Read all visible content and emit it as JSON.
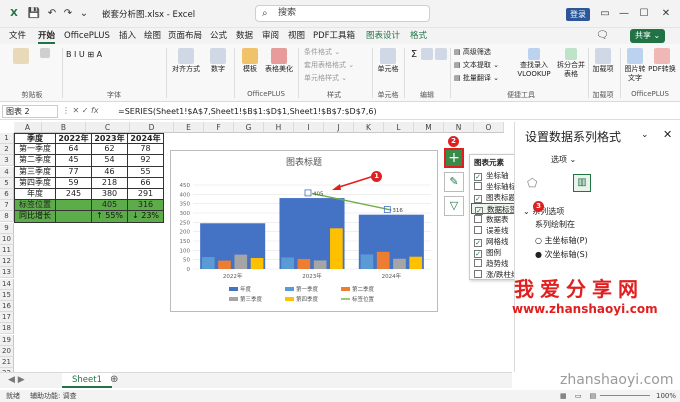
{
  "window": {
    "filename": "嵌套分析图.xlsx",
    "app": "Excel",
    "search_placeholder": "搜索",
    "login": "登录"
  },
  "menu": [
    "文件",
    "开始",
    "OfficePLUS",
    "插入",
    "绘图",
    "页面布局",
    "公式",
    "数据",
    "审阅",
    "视图",
    "PDF工具箱",
    "图表设计",
    "格式"
  ],
  "menu_active": "开始",
  "share": "共享",
  "ribbon": {
    "groups": [
      "剪贴板",
      "字体",
      "OfficePLUS",
      "样式",
      "单元格",
      "编辑",
      "便捷工具",
      "加载项",
      "OfficePLUS"
    ],
    "buttons": [
      "对齐方式",
      "数字",
      "模板",
      "表格美化",
      "条件格式",
      "套用表格格式",
      "单元格样式",
      "单元格",
      "求和",
      "排序和筛选",
      "查找和选择",
      "高级筛选",
      "文本提取",
      "批量翻译",
      "查找录入VLOOKUP",
      "拆分合并表格",
      "加载项",
      "图片转文字",
      "PDF转换"
    ]
  },
  "formulabar": {
    "namebox": "图表 2",
    "formula": "=SERIES(Sheet1!$A$7,Sheet1!$B$1:$D$1,Sheet1!$B$7:$D$7,6)"
  },
  "columns": [
    "A",
    "B",
    "C",
    "D",
    "E",
    "F",
    "G",
    "H",
    "I",
    "J",
    "K",
    "L",
    "M",
    "N",
    "O"
  ],
  "rows": [
    "1",
    "2",
    "3",
    "4",
    "5",
    "6",
    "7",
    "8",
    "9",
    "10",
    "11",
    "12",
    "13",
    "14",
    "15",
    "16",
    "17",
    "18",
    "19",
    "20",
    "21",
    "22"
  ],
  "table": {
    "header": [
      "季度",
      "2022年",
      "2023年",
      "2024年"
    ],
    "body": [
      [
        "第一季度",
        "64",
        "62",
        "78"
      ],
      [
        "第二季度",
        "45",
        "54",
        "92"
      ],
      [
        "第三季度",
        "77",
        "46",
        "55"
      ],
      [
        "第四季度",
        "59",
        "218",
        "66"
      ],
      [
        "年度",
        "245",
        "380",
        "291"
      ],
      [
        "标签位置",
        "",
        "405",
        "316"
      ],
      [
        "同比增长",
        "",
        "↑ 55%",
        "↓ 23%"
      ]
    ]
  },
  "chart_data": {
    "type": "bar",
    "title": "图表标题",
    "categories": [
      "2022年",
      "2023年",
      "2024年"
    ],
    "ylim": [
      0,
      450
    ],
    "yticks": [
      "0",
      "50",
      "100",
      "150",
      "200",
      "250",
      "300",
      "350",
      "400",
      "450"
    ],
    "series": [
      {
        "name": "年度",
        "values": [
          245,
          380,
          291
        ],
        "color": "#4472c4"
      },
      {
        "name": "第一季度",
        "values": [
          64,
          62,
          78
        ],
        "color": "#5b9bd5"
      },
      {
        "name": "第二季度",
        "values": [
          45,
          54,
          92
        ],
        "color": "#ed7d31"
      },
      {
        "name": "第三季度",
        "values": [
          77,
          46,
          55
        ],
        "color": "#a5a5a5"
      },
      {
        "name": "第四季度",
        "values": [
          59,
          218,
          66
        ],
        "color": "#ffc000"
      },
      {
        "name": "标签位置",
        "values": [
          null,
          405,
          316
        ],
        "color": "#70ad47",
        "kind": "line"
      }
    ],
    "data_labels": [
      "405",
      "316"
    ]
  },
  "chart_elements": {
    "title": "图表元素",
    "items": [
      {
        "label": "坐标轴",
        "checked": true
      },
      {
        "label": "坐标轴标题",
        "checked": false
      },
      {
        "label": "图表标题",
        "checked": true
      },
      {
        "label": "数据标签",
        "checked": true
      },
      {
        "label": "数据表",
        "checked": false
      },
      {
        "label": "误差线",
        "checked": false
      },
      {
        "label": "网格线",
        "checked": true
      },
      {
        "label": "图例",
        "checked": true
      },
      {
        "label": "趋势线",
        "checked": false
      },
      {
        "label": "涨/跌柱线",
        "checked": false
      }
    ]
  },
  "pane": {
    "title": "设置数据系列格式",
    "tab": "选项",
    "section": "系列选项",
    "plot_on": "系列绘制在",
    "primary": "主坐标轴(P)",
    "secondary": "次坐标轴(S)"
  },
  "sheet": {
    "tab": "Sheet1"
  },
  "status": {
    "ready": "就绪",
    "accessibility": "辅助功能: 调查",
    "zoom": "100%"
  },
  "badges": [
    "1",
    "2",
    "3"
  ],
  "watermark": {
    "cn": "我爱分享网",
    "url": "www.zhanshaoyi.com",
    "bottom": "zhanshaoyi.com"
  }
}
